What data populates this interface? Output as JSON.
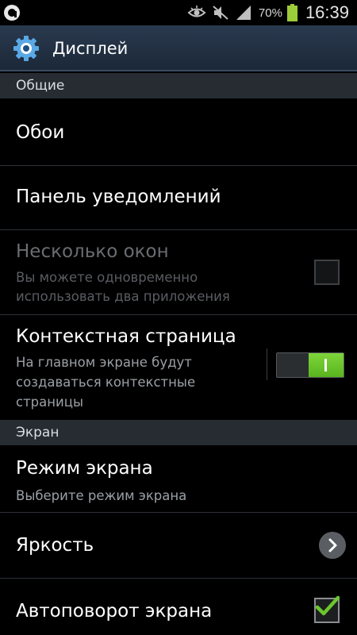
{
  "status_bar": {
    "battery_percent": "70%",
    "time": "16:39",
    "icons": [
      "app-indicator-icon",
      "eye-icon",
      "mute-icon",
      "signal-icon",
      "battery-icon"
    ]
  },
  "header": {
    "icon": "gear-icon",
    "title": "Дисплей"
  },
  "sections": {
    "general": "Общие",
    "screen": "Экран"
  },
  "items": {
    "wallpaper": {
      "title": "Обои"
    },
    "notification_panel": {
      "title": "Панель уведомлений"
    },
    "multi_window": {
      "title": "Несколько окон",
      "sub1": "Вы можете одновременно",
      "sub2": "использовать два приложения",
      "checked": false,
      "enabled": false
    },
    "context_page": {
      "title": "Контекстная страница",
      "sub1": "На главном экране будут",
      "sub2": "создаваться контекстные",
      "sub3": "страницы",
      "on": true
    },
    "screen_mode": {
      "title": "Режим экрана",
      "sub": "Выберите режим экрана"
    },
    "brightness": {
      "title": "Яркость",
      "icon": "chevron-right-icon"
    },
    "auto_rotate": {
      "title": "Автоповорот экрана",
      "checked": true
    }
  },
  "colors": {
    "accent_green": "#6cc62c",
    "action_bar": "#1f2d3f",
    "section_bg": "#272c33"
  }
}
